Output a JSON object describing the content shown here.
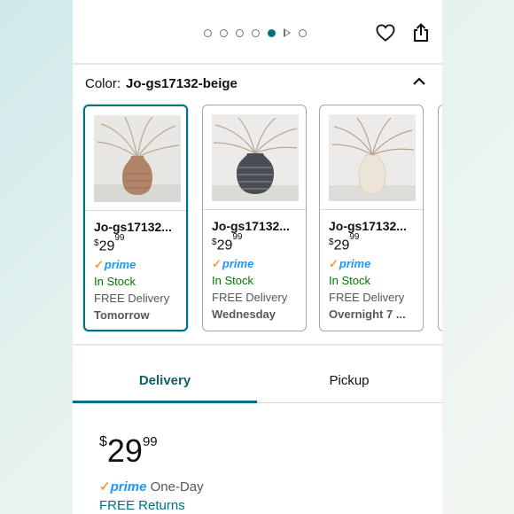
{
  "carousel": {
    "dot_count": 6,
    "active_index": 4,
    "video_index": 5
  },
  "header": {
    "heart_icon": "heart-icon",
    "share_icon": "share-icon"
  },
  "color": {
    "label": "Color:",
    "value": "Jo-gs17132-beige"
  },
  "swatches": [
    {
      "name": "Jo-gs17132...",
      "price_currency": "$",
      "price_whole": "29",
      "price_fraction": "99",
      "prime": "prime",
      "stock": "In Stock",
      "delivery": "FREE Delivery",
      "delivery_day": "Tomorrow",
      "vase_color": "#b08466"
    },
    {
      "name": "Jo-gs17132...",
      "price_currency": "$",
      "price_whole": "29",
      "price_fraction": "99",
      "prime": "prime",
      "stock": "In Stock",
      "delivery": "FREE Delivery",
      "delivery_day": "Wednesday",
      "vase_color": "#4a4d54"
    },
    {
      "name": "Jo-gs17132...",
      "price_currency": "$",
      "price_whole": "29",
      "price_fraction": "99",
      "prime": "prime",
      "stock": "In Stock",
      "delivery": "FREE Delivery",
      "delivery_day": "Overnight 7 ...",
      "vase_color": "#ece4d6"
    }
  ],
  "tabs": [
    {
      "label": "Delivery",
      "active": true
    },
    {
      "label": "Pickup",
      "active": false
    }
  ],
  "offer": {
    "currency": "$",
    "whole": "29",
    "fraction": "99",
    "prime": "prime",
    "prime_suffix": "One-Day",
    "returns": "FREE Returns"
  },
  "colors": {
    "accent": "#007185",
    "prime_blue": "#1a98ff",
    "in_stock": "#007600",
    "prime_check": "#f79b34"
  }
}
